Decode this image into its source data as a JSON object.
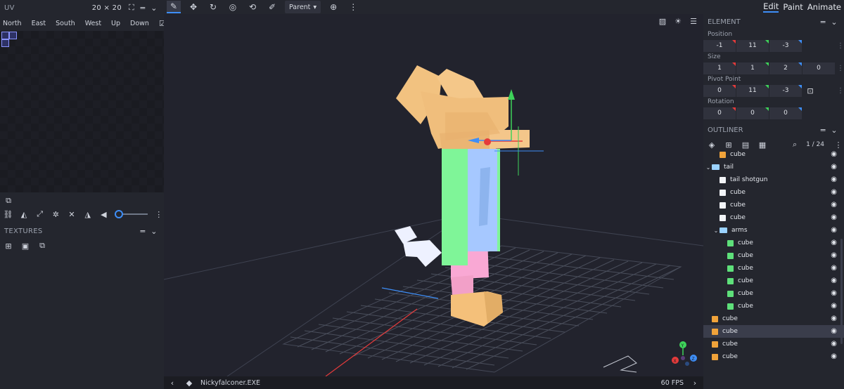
{
  "uv_panel": {
    "title": "UV",
    "size_label": "20 × 20",
    "faces": [
      "North",
      "East",
      "South",
      "West",
      "Up",
      "Down"
    ]
  },
  "textures_panel": {
    "title": "TEXTURES"
  },
  "toolbar": {
    "pivot_mode": "Parent"
  },
  "viewport": {
    "fps": "60 FPS",
    "file_name": "Nickyfalconer.EXE"
  },
  "mode_tabs": [
    "Edit",
    "Paint",
    "Animate"
  ],
  "element_panel": {
    "title": "ELEMENT",
    "position_label": "Position",
    "position": [
      "-1",
      "11",
      "-3"
    ],
    "size_label": "Size",
    "size": [
      "1",
      "1",
      "2",
      "0"
    ],
    "pivot_label": "Pivot Point",
    "pivot": [
      "0",
      "11",
      "-3"
    ],
    "rotation_label": "Rotation",
    "rotation": [
      "0",
      "0",
      "0"
    ]
  },
  "outliner": {
    "title": "OUTLINER",
    "count": "1 / 24",
    "nodes": [
      {
        "label": "cube",
        "kind": "cube",
        "color": "orange",
        "depth": 1
      },
      {
        "label": "tail",
        "kind": "folder",
        "depth": 0
      },
      {
        "label": "tail shotgun",
        "kind": "cube",
        "color": "white",
        "depth": 1
      },
      {
        "label": "cube",
        "kind": "cube",
        "color": "white",
        "depth": 1
      },
      {
        "label": "cube",
        "kind": "cube",
        "color": "white",
        "depth": 1
      },
      {
        "label": "cube",
        "kind": "cube",
        "color": "white",
        "depth": 1
      },
      {
        "label": "arms",
        "kind": "folder",
        "depth": 1
      },
      {
        "label": "cube",
        "kind": "cube",
        "color": "green",
        "depth": 2
      },
      {
        "label": "cube",
        "kind": "cube",
        "color": "green",
        "depth": 2
      },
      {
        "label": "cube",
        "kind": "cube",
        "color": "green",
        "depth": 2
      },
      {
        "label": "cube",
        "kind": "cube",
        "color": "green",
        "depth": 2
      },
      {
        "label": "cube",
        "kind": "cube",
        "color": "green",
        "depth": 2
      },
      {
        "label": "cube",
        "kind": "cube",
        "color": "green",
        "depth": 2
      },
      {
        "label": "cube",
        "kind": "cube",
        "color": "orange",
        "depth": 0
      },
      {
        "label": "cube",
        "kind": "cube",
        "color": "orange",
        "depth": 0,
        "selected": true
      },
      {
        "label": "cube",
        "kind": "cube",
        "color": "orange",
        "depth": 0
      },
      {
        "label": "cube",
        "kind": "cube",
        "color": "orange",
        "depth": 0
      }
    ]
  },
  "colors": {
    "accent": "#3e8ef7",
    "panel": "#24262e",
    "viewport": "#22232d",
    "axis_x": "#e53b3b",
    "axis_y": "#3ed35a",
    "axis_z": "#3e8ef7"
  }
}
